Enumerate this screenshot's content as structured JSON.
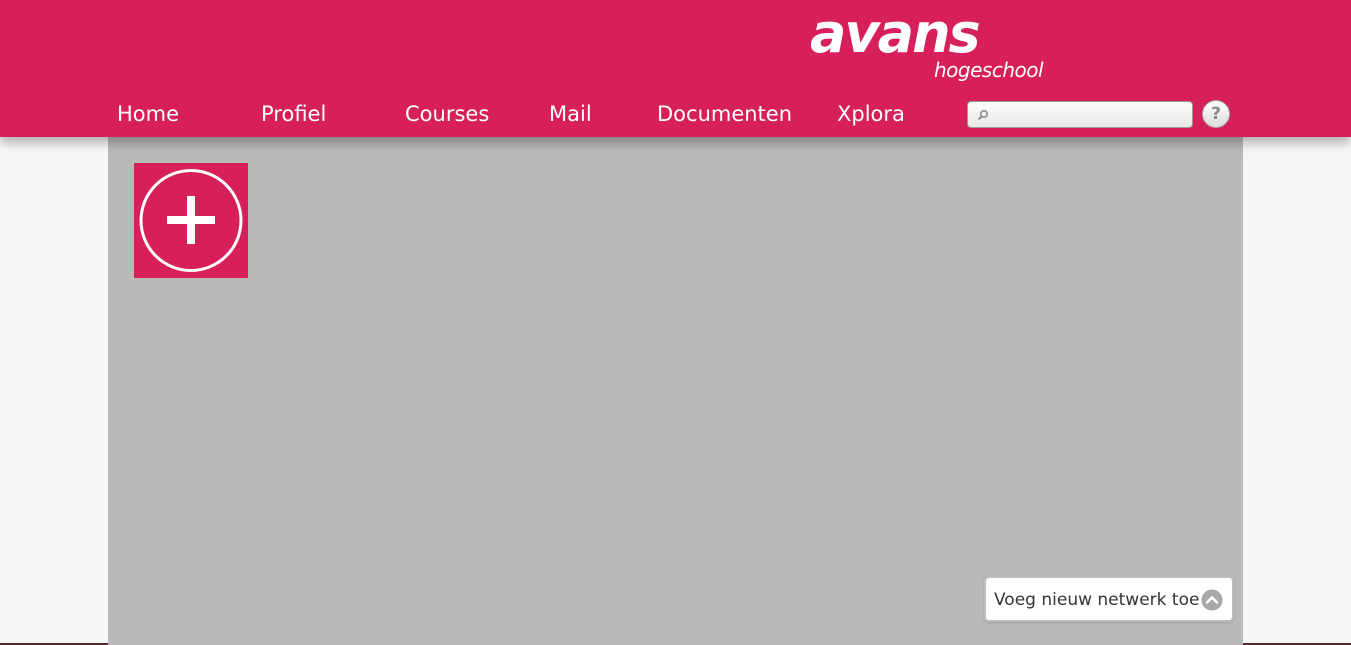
{
  "brand": {
    "name": "avans",
    "subtitle": "hogeschool",
    "accent_color": "#d71f59"
  },
  "nav": {
    "items": [
      {
        "label": "Home"
      },
      {
        "label": "Profiel"
      },
      {
        "label": "Courses"
      },
      {
        "label": "Mail"
      },
      {
        "label": "Documenten"
      },
      {
        "label": "Xplora"
      }
    ]
  },
  "search": {
    "value": "",
    "placeholder": "",
    "icon": "search-icon"
  },
  "help": {
    "label": "?",
    "icon": "help-icon"
  },
  "content": {
    "background_color": "#b9b9b9",
    "add_tile": {
      "icon": "plus-circle-icon"
    },
    "add_network_button": {
      "label": "Voeg nieuw netwerk toe",
      "icon": "chevron-up-icon"
    }
  }
}
